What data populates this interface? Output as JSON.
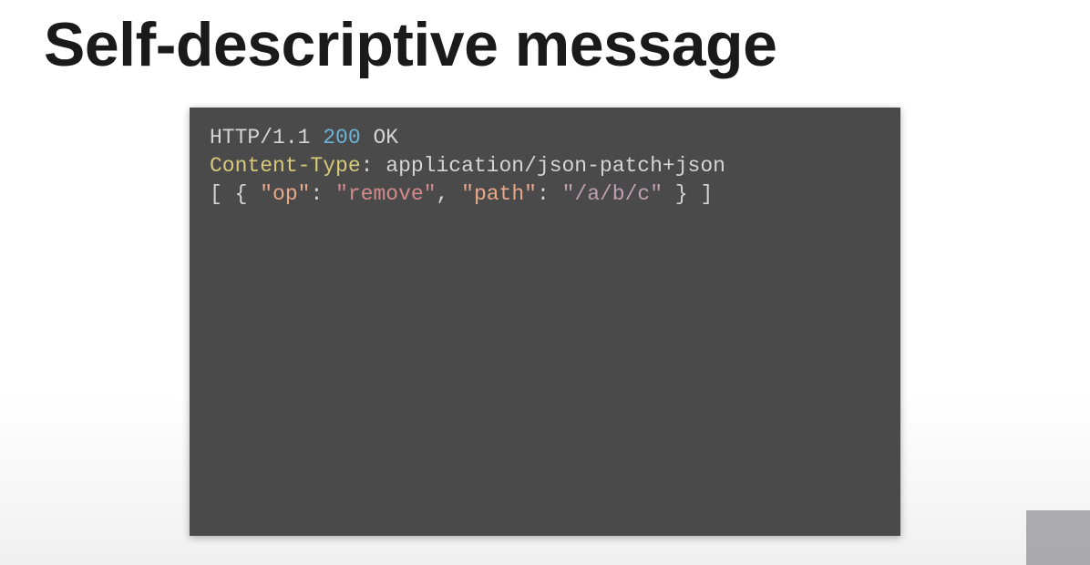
{
  "slide": {
    "title": "Self-descriptive message"
  },
  "code": {
    "line1": {
      "protocol": "HTTP/1.1",
      "status_code": "200",
      "status_text": "OK"
    },
    "line2": {
      "header_name": "Content-Type",
      "colon": ":",
      "header_value": "application/json-patch+json"
    },
    "line3_blank": "",
    "line4": {
      "open": "[ { ",
      "key_op_quote1": "\"",
      "key_op": "op",
      "key_op_quote2": "\"",
      "colon1": ": ",
      "val_remove_quote1": "\"",
      "val_remove": "remove",
      "val_remove_quote2": "\"",
      "comma": ", ",
      "key_path_quote1": "\"",
      "key_path": "path",
      "key_path_quote2": "\"",
      "colon2": ": ",
      "val_path_quote1": "\"",
      "val_path": "/a/b/c",
      "val_path_quote2": "\"",
      "close": " } ]"
    }
  }
}
